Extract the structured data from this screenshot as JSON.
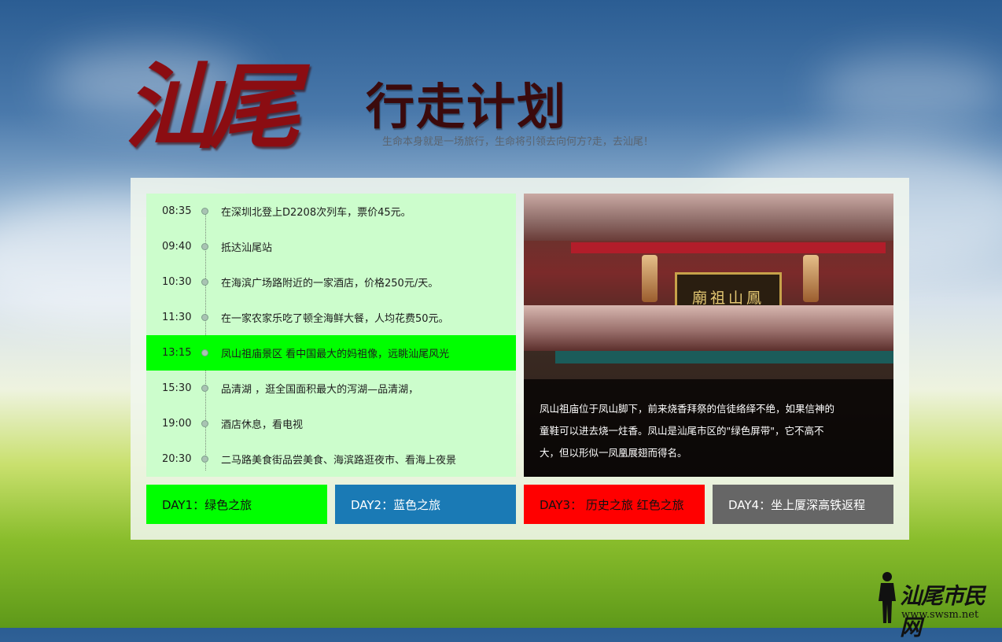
{
  "header": {
    "title_main": "汕尾",
    "title_sub": "行走计划",
    "tagline": "生命本身就是一场旅行，生命将引领去向何方?走，去汕尾！"
  },
  "timeline": [
    {
      "time": "08:35",
      "text": "在深圳北登上D2208次列车，票价45元。",
      "active": false
    },
    {
      "time": "09:40",
      "text": "抵达汕尾站",
      "active": false
    },
    {
      "time": "10:30",
      "text": " 在海滨广场路附近的一家酒店，价格250元/天。",
      "active": false
    },
    {
      "time": "11:30",
      "text": "在一家农家乐吃了顿全海鲜大餐，人均花费50元。",
      "active": false
    },
    {
      "time": "13:15",
      "text": "凤山祖庙景区 看中国最大的妈祖像，远眺汕尾风光",
      "active": true
    },
    {
      "time": "15:30",
      "text": " 品清湖 ，逛全国面积最大的泻湖—品清湖，",
      "active": false
    },
    {
      "time": "19:00",
      "text": "酒店休息，看电视",
      "active": false
    },
    {
      "time": "20:30",
      "text": "二马路美食街品尝美食、海滨路逛夜市、看海上夜景",
      "active": false
    }
  ],
  "photo": {
    "plaque_text": "廟祖山鳳",
    "caption_lines": [
      "凤山祖庙位于凤山脚下，前来烧香拜祭的信徒络绎不绝，如果信神的",
      "童鞋可以进去烧一炷香。凤山是汕尾市区的\"绿色屏带\"，它不高不",
      "大，但以形似一凤凰展翅而得名。"
    ]
  },
  "days": [
    {
      "label": "DAY1：绿色之旅",
      "color": "#00ff00"
    },
    {
      "label": "DAY2：蓝色之旅",
      "color": "#1a7ab5"
    },
    {
      "label": "DAY3： 历史之旅 红色之旅",
      "color": "#ff0000"
    },
    {
      "label": "DAY4：坐上厦深高铁返程",
      "color": "#666666"
    }
  ],
  "logo": {
    "text": "汕尾市民网",
    "url": "www.swsm.net"
  },
  "icons": {
    "timeline_dot": "circle-dot-icon",
    "logo_figure": "person-silhouette-icon"
  }
}
